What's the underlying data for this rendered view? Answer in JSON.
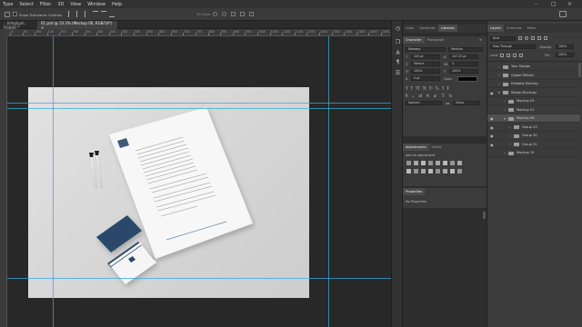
{
  "menu": [
    "Type",
    "Select",
    "Filter",
    "3D",
    "View",
    "Window",
    "Help"
  ],
  "options_bar": {
    "show_transform_controls": "Show Transform Controls",
    "mode_3d": "3D Mode:"
  },
  "document_tabs": [
    {
      "label": "...Infoglyph, RGB/8) *",
      "active": false
    },
    {
      "label": "01.psd @ 33.3% (Mockup 06, RGB/16*) ×",
      "active": true
    }
  ],
  "ruler_marks": [
    "0",
    "50",
    "100",
    "150",
    "200",
    "250",
    "300",
    "350",
    "400",
    "450",
    "500",
    "550",
    "600",
    "650",
    "700",
    "750",
    "800",
    "850",
    "900",
    "950",
    "1000",
    "1050",
    "1100",
    "1150",
    "1200",
    "1250",
    "1300",
    "1350",
    "1400",
    "1450",
    "1500"
  ],
  "document": {
    "card_front_text": "",
    "letter_title": ""
  },
  "mid_panel": {
    "top_tabs": [
      "Color",
      "Swatches",
      "Libraries"
    ],
    "char_tabs": [
      "Character",
      "Paragraph"
    ],
    "font_family": "Raleway",
    "font_style": "Medium",
    "font_size": "105 pt",
    "leading": "107.22 pt",
    "kerning": "Metrics",
    "tracking": "0",
    "vscale": "100%",
    "hscale": "100%",
    "baseline": "0 pt",
    "color_label": "Color:",
    "language": "Spanish",
    "aa": "Sharp",
    "adjust_tabs": [
      "Adjustments",
      "Styles"
    ],
    "adjust_hint": "Add an adjustment",
    "properties_tab": "Properties",
    "properties_text": "No Properties"
  },
  "layers_panel": {
    "tabs": [
      "Layers",
      "Channels",
      "Paths"
    ],
    "filter": "Kind",
    "blend_mode": "Pass Through",
    "opacity_label": "Opacity:",
    "opacity": "100%",
    "lock_label": "Lock:",
    "fill_label": "Fill:",
    "fill": "100%",
    "layers": [
      {
        "name": "Your Design",
        "indent": 0,
        "eye": false,
        "open": false,
        "selected": false
      },
      {
        "name": "Global Effects",
        "indent": 0,
        "eye": false,
        "open": false,
        "selected": false
      },
      {
        "name": "Editable Mockup",
        "indent": 0,
        "eye": false,
        "open": false,
        "selected": false
      },
      {
        "name": "Ready Mockups",
        "indent": 0,
        "eye": true,
        "open": true,
        "selected": false
      },
      {
        "name": "Mockup 02",
        "indent": 1,
        "eye": false,
        "open": false,
        "selected": false
      },
      {
        "name": "Mockup 01",
        "indent": 1,
        "eye": false,
        "open": false,
        "selected": false
      },
      {
        "name": "Mockup 06",
        "indent": 1,
        "eye": true,
        "open": true,
        "selected": true
      },
      {
        "name": "Group 29",
        "indent": 2,
        "eye": true,
        "open": false,
        "selected": false
      },
      {
        "name": "Group 30",
        "indent": 2,
        "eye": true,
        "open": false,
        "selected": false
      },
      {
        "name": "Group 31",
        "indent": 2,
        "eye": true,
        "open": false,
        "selected": false
      },
      {
        "name": "Mockup 15",
        "indent": 1,
        "eye": false,
        "open": false,
        "selected": false
      }
    ]
  },
  "colors": {
    "accent_guide": "#39a7d6",
    "card_navy": "#2b4a6a"
  }
}
